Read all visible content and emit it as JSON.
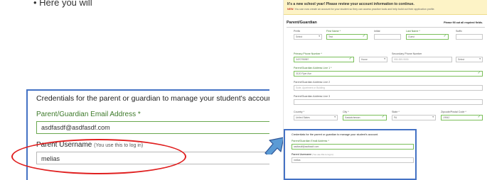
{
  "top_text": "• Here you will",
  "callout": {
    "title": "Credentials for the parent or guardian to manage your student's account.",
    "email_label": "Parent/Guardian Email Address *",
    "email_value": "asdfasdf@asdfasdf.com",
    "username_label": "Parent Username",
    "username_hint": "(You use this to log in)",
    "username_value": "melias"
  },
  "form": {
    "banner_title": "It's a new school year! Please review your account information to continue.",
    "banner_new": "NEW:",
    "banner_text": "You can now create an account for your student so they can access practice tools and help build out their application profile.",
    "section_title": "Parent/Guardian",
    "required_note": "Please fill out all required fields.",
    "prefix": {
      "label": "Prefix",
      "value": "Select"
    },
    "first_name": {
      "label": "First Name *",
      "value": "Test"
    },
    "initial": {
      "label": "Initial",
      "value": ""
    },
    "last_name": {
      "label": "Last Name *",
      "value": "Guest"
    },
    "suffix": {
      "label": "Suffix",
      "value": ""
    },
    "primary_phone": {
      "label": "Primary Phone Number *",
      "value": "3470795987"
    },
    "phone_type": {
      "value": "Home"
    },
    "secondary_phone": {
      "label": "Secondary Phone Number",
      "placeholder": "555-555-5555"
    },
    "phone_type2": {
      "value": "Select"
    },
    "address1": {
      "label": "Parent/Guardian Address Line 1 *",
      "value": "3120 Flyer Ave"
    },
    "address2": {
      "label": "Parent/Guardian Address Line 2",
      "placeholder": "Suite, Apartment or Building"
    },
    "address3": {
      "label": "Parent/Guardian Address Line 3",
      "value": ""
    },
    "country": {
      "label": "Country *",
      "value": "United States"
    },
    "city": {
      "label": "City *",
      "value": "Saskatchewan"
    },
    "state": {
      "label": "State *",
      "value": "PA"
    },
    "zip": {
      "label": "Zipcode/Postal Code *",
      "value": "19942"
    },
    "creds_title": "Credentials for the parent or guardian to manage your student's account.",
    "creds_email_label": "Parent/Guardian Email Address *",
    "creds_email_value": "asdfasdf@asdfasdf.com",
    "creds_username_label": "Parent Username",
    "creds_username_hint": "(You use this to log in)",
    "creds_username_value": "melias"
  },
  "colors": {
    "accent_blue": "#4472c4",
    "valid_green": "#6aa84f",
    "highlight_red": "#e02020",
    "banner_yellow": "#fdf3c6"
  }
}
